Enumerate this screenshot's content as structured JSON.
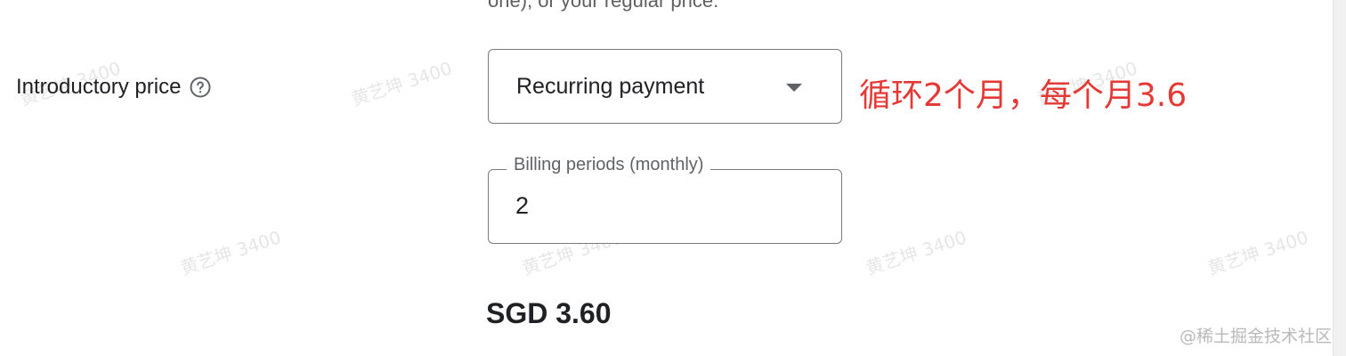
{
  "top_clipped_text": "one), or your regular price.",
  "introductory_price": {
    "label": "Introductory price",
    "help_icon": "help-circle-icon"
  },
  "payment_select": {
    "value": "Recurring payment",
    "arrow_icon": "dropdown-arrow-icon"
  },
  "annotation": {
    "text": "循环2个月，每个月3.6",
    "color": "#e53935"
  },
  "billing_periods": {
    "label": "Billing periods (monthly)",
    "value": "2"
  },
  "price_total": "SGD 3.60",
  "watermark_text": "黄艺坤 3400",
  "credit": "@稀土掘金技术社区"
}
